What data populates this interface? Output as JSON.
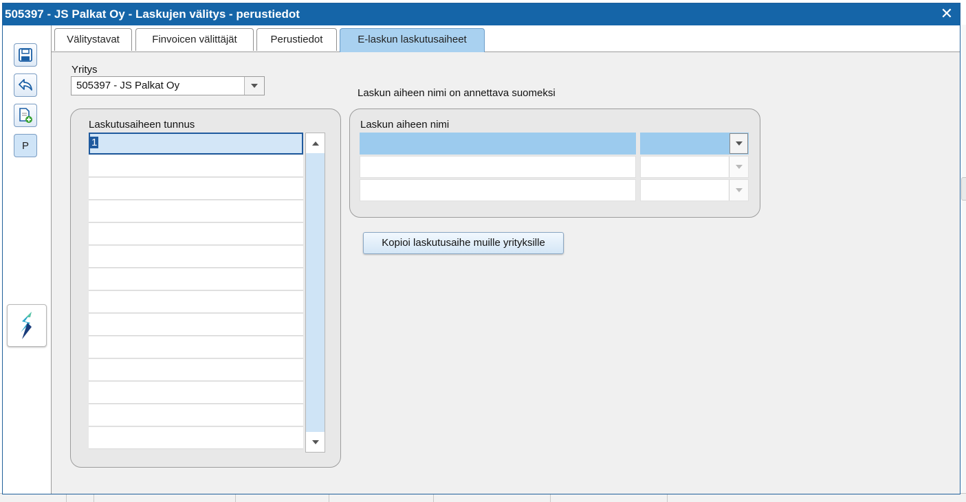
{
  "window": {
    "title": "505397 - JS Palkat Oy - Laskujen välitys - perustiedot",
    "close_symbol": "✕"
  },
  "toolbar": {
    "buttons": [
      {
        "name": "save-icon"
      },
      {
        "name": "undo-icon"
      },
      {
        "name": "new-document-icon"
      },
      {
        "name": "p-button",
        "label": "P"
      }
    ],
    "logo": "app-logo-icon"
  },
  "tabs": [
    {
      "label": "Välitystavat",
      "active": false
    },
    {
      "label": "Finvoicen välittäjät",
      "active": false
    },
    {
      "label": "Perustiedot",
      "active": false
    },
    {
      "label": "E-laskun laskutusaiheet",
      "active": true
    }
  ],
  "company": {
    "label": "Yritys",
    "value": "505397 - JS Palkat Oy"
  },
  "notice": "Laskun aiheen nimi on annettava suomeksi",
  "subject_codes": {
    "header": "Laskutusaiheen tunnus",
    "rows": [
      "1",
      "",
      "",
      "",
      "",
      "",
      "",
      "",
      "",
      "",
      "",
      "",
      "",
      ""
    ]
  },
  "subject_names": {
    "header": "Laskun aiheen nimi",
    "rows": [
      {
        "name": "",
        "language": ""
      },
      {
        "name": "",
        "language": ""
      },
      {
        "name": "",
        "language": ""
      }
    ]
  },
  "copy_button": "Kopioi laskutusaihe muille yrityksille",
  "colors": {
    "titlebar": "#1565a8",
    "active_tab": "#a9d1f0",
    "selection": "#9ccbee",
    "selected_border": "#1f5a9e"
  }
}
